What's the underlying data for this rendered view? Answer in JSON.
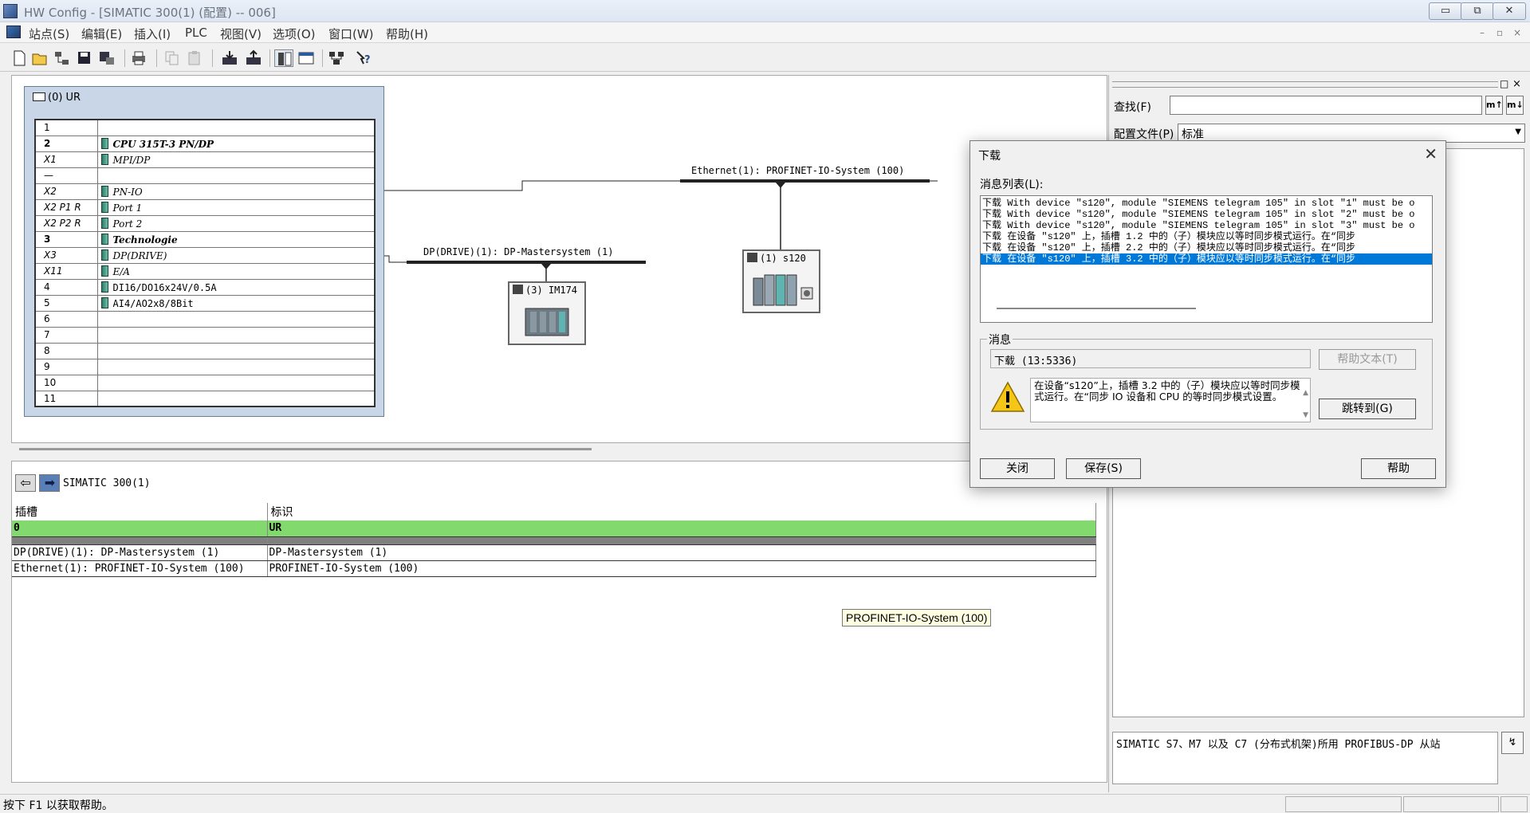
{
  "window": {
    "title": "HW Config - [SIMATIC 300(1) (配置) -- 006]",
    "controls": [
      "▭",
      "⧉",
      "✕"
    ]
  },
  "menu": {
    "items": [
      "站点(S)",
      "编辑(E)",
      "插入(I)",
      "PLC",
      "视图(V)",
      "选项(O)",
      "窗口(W)",
      "帮助(H)"
    ],
    "mdi_controls": [
      "–",
      "▫",
      "×"
    ]
  },
  "toolbar": {
    "icons": [
      "new-icon",
      "open-icon",
      "network-icon",
      "save-icon",
      "save-compile-icon",
      "print-icon",
      "copy-icon",
      "paste-icon",
      "download-icon",
      "upload-icon",
      "catalog-icon",
      "window-icon",
      "network-view-icon",
      "help-icon"
    ]
  },
  "station": {
    "rack_title": "(0)  UR",
    "rows": [
      {
        "slot": "1",
        "module": ""
      },
      {
        "slot": "2",
        "module": "CPU 315T-3 PN/DP"
      },
      {
        "slot": "X1",
        "module": "MPI/DP"
      },
      {
        "slot": "—",
        "module": ""
      },
      {
        "slot": "X2",
        "module": "PN-IO"
      },
      {
        "slot": "X2 P1 R",
        "module": "Port 1"
      },
      {
        "slot": "X2 P2 R",
        "module": "Port 2"
      },
      {
        "slot": "3",
        "module": "Technologie"
      },
      {
        "slot": "X3",
        "module": "DP(DRIVE)"
      },
      {
        "slot": "X11",
        "module": "E/A"
      },
      {
        "slot": "4",
        "module": "DI16/DO16x24V/0.5A"
      },
      {
        "slot": "5",
        "module": "AI4/AO2x8/8Bit"
      },
      {
        "slot": "6",
        "module": ""
      },
      {
        "slot": "7",
        "module": ""
      },
      {
        "slot": "8",
        "module": ""
      },
      {
        "slot": "9",
        "module": ""
      },
      {
        "slot": "10",
        "module": ""
      },
      {
        "slot": "11",
        "module": ""
      }
    ],
    "ethernet_label": "Ethernet(1): PROFINET-IO-System (100)",
    "dp_label": "DP(DRIVE)(1): DP-Mastersystem (1)",
    "device_s120": "(1) s120",
    "device_im174": "(3) IM174"
  },
  "catalog": {
    "find_label": "查找(F)",
    "find_value": "",
    "find_buttons": [
      "m↑",
      "m↓"
    ],
    "profile_label": "配置文件(P)",
    "profile_value": "标准",
    "description": "SIMATIC S7、M7 以及 C7 (分布式机架)所用 PROFIBUS-DP 从站",
    "desc_button": "↯"
  },
  "detail": {
    "title": "SIMATIC 300(1)",
    "col_slot": "插槽",
    "col_id": "标识",
    "rows": [
      {
        "slot": "0",
        "id": "UR"
      },
      {
        "slot": "DP(DRIVE)(1): DP-Mastersystem (1)",
        "id": "DP-Mastersystem (1)"
      },
      {
        "slot": "Ethernet(1): PROFINET-IO-System (100)",
        "id": "PROFINET-IO-System (100)"
      }
    ]
  },
  "tooltip": "PROFINET-IO-System (100)",
  "status": {
    "text": "按下 F1 以获取帮助。"
  },
  "dialog": {
    "title": "下载",
    "list_label": "消息列表(L):",
    "messages": [
      "下载 With device \"s120\", module \"SIEMENS telegram 105\" in slot \"1\" must be o",
      "下载 With device \"s120\", module \"SIEMENS telegram 105\" in slot \"2\" must be o",
      "下载 With device \"s120\", module \"SIEMENS telegram 105\" in slot \"3\" must be o",
      "下载 在设备 \"s120\" 上，插槽 1.2 中的（子）模块应以等时同步模式运行。在“同步",
      "下载 在设备 \"s120\" 上，插槽 2.2 中的（子）模块应以等时同步模式运行。在“同步",
      "下载 在设备 \"s120\" 上，插槽 3.2 中的（子）模块应以等时同步模式运行。在“同步"
    ],
    "message_group": "消息",
    "message_code": "下载 (13:5336)",
    "message_text": "在设备“s120”上，插槽 3.2 中的（子）模块应以等时同步模式运行。在“同步 IO 设备和 CPU 的等时同步模式设置。",
    "help_text_button": "帮助文本(T)",
    "goto_button": "跳转到(G)",
    "close_button": "关闭",
    "save_button": "保存(S)",
    "help_button": "帮助"
  }
}
